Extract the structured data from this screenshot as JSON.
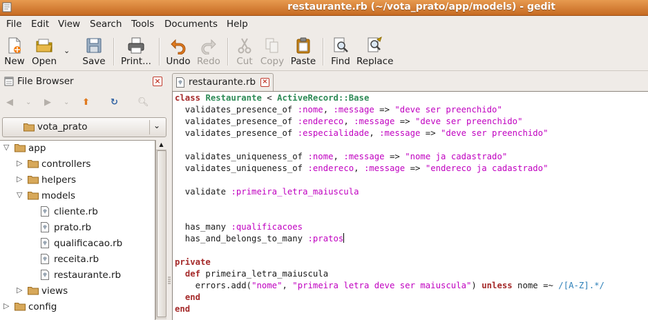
{
  "window": {
    "title": "restaurante.rb (~/vota_prato/app/models) - gedit"
  },
  "menu": [
    "File",
    "Edit",
    "View",
    "Search",
    "Tools",
    "Documents",
    "Help"
  ],
  "toolbar": {
    "new": "New",
    "open": "Open",
    "save": "Save",
    "print": "Print...",
    "undo": "Undo",
    "redo": "Redo",
    "cut": "Cut",
    "copy": "Copy",
    "paste": "Paste",
    "find": "Find",
    "replace": "Replace"
  },
  "side_panel": {
    "title": "File Browser",
    "location": "vota_prato",
    "tree": [
      {
        "label": "app",
        "depth": 0,
        "type": "folder",
        "expanded": true
      },
      {
        "label": "controllers",
        "depth": 1,
        "type": "folder",
        "expanded": false
      },
      {
        "label": "helpers",
        "depth": 1,
        "type": "folder",
        "expanded": false
      },
      {
        "label": "models",
        "depth": 1,
        "type": "folder",
        "expanded": true
      },
      {
        "label": "cliente.rb",
        "depth": 2,
        "type": "file"
      },
      {
        "label": "prato.rb",
        "depth": 2,
        "type": "file"
      },
      {
        "label": "qualificacao.rb",
        "depth": 2,
        "type": "file"
      },
      {
        "label": "receita.rb",
        "depth": 2,
        "type": "file"
      },
      {
        "label": "restaurante.rb",
        "depth": 2,
        "type": "file"
      },
      {
        "label": "views",
        "depth": 1,
        "type": "folder",
        "expanded": false
      },
      {
        "label": "config",
        "depth": 0,
        "type": "folder",
        "expanded": false
      }
    ]
  },
  "document": {
    "tab_label": "restaurante.rb",
    "lines": [
      [
        [
          "kw",
          "class"
        ],
        [
          "t",
          " "
        ],
        [
          "cls",
          "Restaurante"
        ],
        [
          "t",
          " < "
        ],
        [
          "cls",
          "ActiveRecord::Base"
        ]
      ],
      [
        [
          "t",
          "  validates_presence_of "
        ],
        [
          "sym",
          ":nome"
        ],
        [
          "t",
          ", "
        ],
        [
          "sym",
          ":message"
        ],
        [
          "t",
          " => "
        ],
        [
          "str",
          "\"deve ser preenchido\""
        ]
      ],
      [
        [
          "t",
          "  validates_presence_of "
        ],
        [
          "sym",
          ":endereco"
        ],
        [
          "t",
          ", "
        ],
        [
          "sym",
          ":message"
        ],
        [
          "t",
          " => "
        ],
        [
          "str",
          "\"deve ser preenchido\""
        ]
      ],
      [
        [
          "t",
          "  validates_presence_of "
        ],
        [
          "sym",
          ":especialidade"
        ],
        [
          "t",
          ", "
        ],
        [
          "sym",
          ":message"
        ],
        [
          "t",
          " => "
        ],
        [
          "str",
          "\"deve ser preenchido\""
        ]
      ],
      [],
      [
        [
          "t",
          "  validates_uniqueness_of "
        ],
        [
          "sym",
          ":nome"
        ],
        [
          "t",
          ", "
        ],
        [
          "sym",
          ":message"
        ],
        [
          "t",
          " => "
        ],
        [
          "str",
          "\"nome ja cadastrado\""
        ]
      ],
      [
        [
          "t",
          "  validates_uniqueness_of "
        ],
        [
          "sym",
          ":endereco"
        ],
        [
          "t",
          ", "
        ],
        [
          "sym",
          ":message"
        ],
        [
          "t",
          " => "
        ],
        [
          "str",
          "\"endereco ja cadastrado\""
        ]
      ],
      [],
      [
        [
          "t",
          "  validate "
        ],
        [
          "sym",
          ":primeira_letra_maiuscula"
        ]
      ],
      [],
      [],
      [
        [
          "t",
          "  has_many "
        ],
        [
          "sym",
          ":qualificacoes"
        ]
      ],
      [
        [
          "t",
          "  has_and_belongs_to_many "
        ],
        [
          "sym",
          ":pratos"
        ],
        [
          "caret",
          ""
        ]
      ],
      [],
      [
        [
          "kw",
          "private"
        ]
      ],
      [
        [
          "t",
          "  "
        ],
        [
          "kw",
          "def"
        ],
        [
          "t",
          " primeira_letra_maiuscula"
        ]
      ],
      [
        [
          "t",
          "    errors.add("
        ],
        [
          "str",
          "\"nome\""
        ],
        [
          "t",
          ", "
        ],
        [
          "str",
          "\"primeira letra deve ser maiuscula\""
        ],
        [
          "t",
          ") "
        ],
        [
          "kw",
          "unless"
        ],
        [
          "t",
          " nome =~ "
        ],
        [
          "rx",
          "/[A-Z].*/"
        ]
      ],
      [
        [
          "t",
          "  "
        ],
        [
          "kw",
          "end"
        ]
      ],
      [
        [
          "kw",
          "end"
        ]
      ]
    ]
  },
  "colors": {
    "titlebar": "#d97a30",
    "keyword": "#a52a2a",
    "class_name": "#2e8b57",
    "symbol": "#c000c0",
    "regex": "#2c7fb8",
    "close_icon": "#c0392b"
  }
}
